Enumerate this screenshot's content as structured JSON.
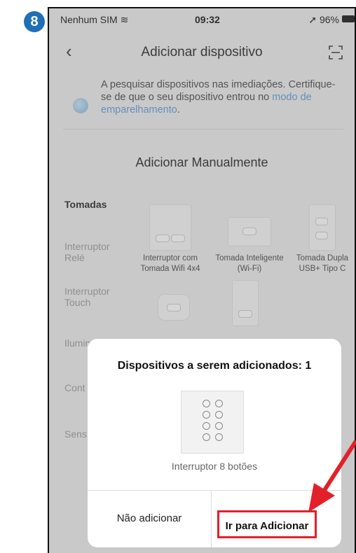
{
  "step_number": "8",
  "status": {
    "carrier": "Nenhum SIM",
    "time": "09:32",
    "battery": "96%"
  },
  "nav": {
    "title": "Adicionar dispositivo"
  },
  "search": {
    "text": "A pesquisar dispositivos nas imediações. Certifique-se de que o seu dispositivo entrou no",
    "link": "modo de emparelhamento",
    "end": "."
  },
  "manual_title": "Adicionar Manualmente",
  "categories": [
    "Tomadas",
    "Interruptor Relé",
    "Interruptor Touch",
    "Ilumin",
    "Cont",
    "Sens"
  ],
  "products": [
    {
      "name": "Interruptor com Tomada Wifi 4x4"
    },
    {
      "name": "Tomada Inteligente (Wi-Fi)"
    },
    {
      "name": "Tomada Dupla USB+ Tipo C"
    }
  ],
  "modal": {
    "title": "Dispositivos a serem adicionados: 1",
    "device_name": "Interruptor 8 botões",
    "cancel_label": "Não adicionar",
    "confirm_label": "Ir para Adicionar"
  },
  "colors": {
    "accent": "#e3202a",
    "link": "#5a9bd6",
    "step_badge": "#1f6fb8"
  }
}
